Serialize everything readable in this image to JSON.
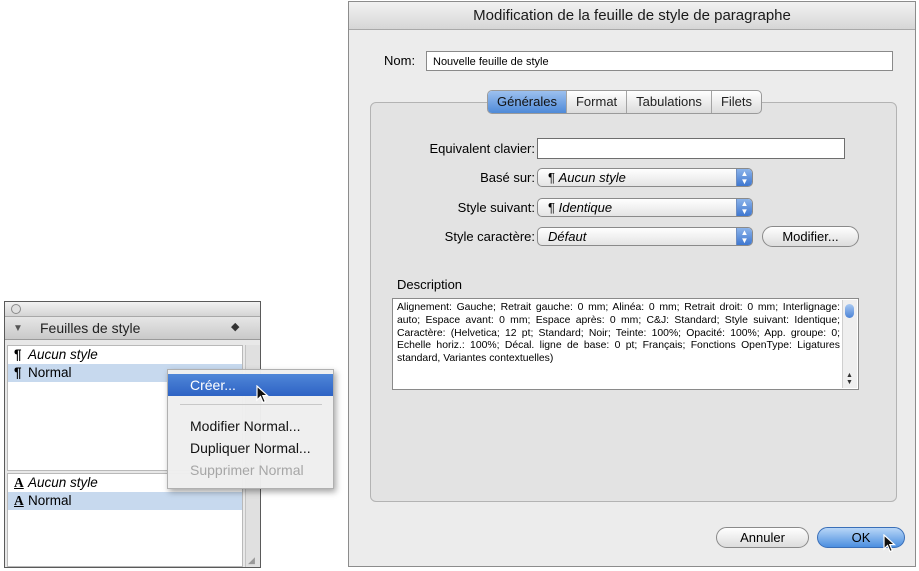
{
  "palette": {
    "title": "Feuilles de style",
    "paragraph_styles": [
      "Aucun style",
      "Normal"
    ],
    "character_styles": [
      "Aucun style",
      "Normal"
    ]
  },
  "context_menu": {
    "items": [
      "Créer...",
      "Modifier Normal...",
      "Dupliquer Normal...",
      "Supprimer Normal"
    ]
  },
  "dialog": {
    "title": "Modification de la feuille de style de paragraphe",
    "name_label": "Nom:",
    "name_value": "Nouvelle feuille de style",
    "tabs": [
      "Générales",
      "Format",
      "Tabulations",
      "Filets"
    ],
    "active_tab": "Générales",
    "fields": {
      "shortcut_label": "Equivalent clavier:",
      "based_on_label": "Basé sur:",
      "based_on_value": "Aucun style",
      "next_style_label": "Style suivant:",
      "next_style_value": "Identique",
      "char_style_label": "Style caractère:",
      "char_style_value": "Défaut",
      "modify_button": "Modifier..."
    },
    "description_label": "Description",
    "description_text": "Alignement: Gauche;  Retrait gauche: 0 mm;  Alinéa: 0 mm;  Retrait droit: 0 mm;  Interlignage: auto;  Espace avant: 0 mm;  Espace après: 0 mm;  C&J: Standard;  Style suivant: Identique;  Caractère: (Helvetica;  12 pt;  Standard;  Noir;  Teinte: 100%;  Opacité: 100%;  App. groupe: 0;  Echelle horiz.: 100%;  Décal. ligne de base: 0 pt;  Français;  Fonctions OpenType: Ligatures standard, Variantes contextuelles)",
    "cancel_button": "Annuler",
    "ok_button": "OK"
  },
  "colors": {
    "selection": "#c7d9ee",
    "menu_highlight": "#2e63c4",
    "aqua_blue": "#4c8fe0"
  }
}
